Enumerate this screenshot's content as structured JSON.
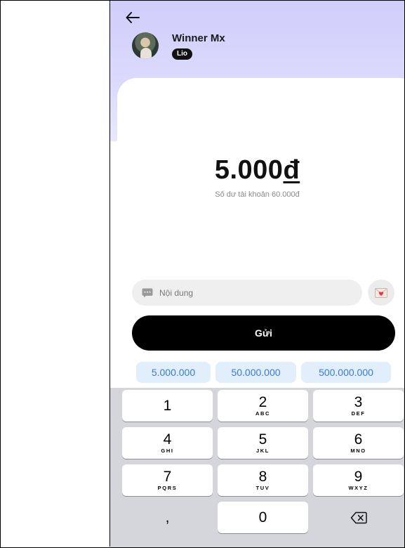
{
  "header": {
    "user_name": "Winner Mx",
    "badge": "Lio"
  },
  "transfer": {
    "amount": "5.000",
    "currency_symbol": "đ",
    "balance_text": "Số dư tài khoản 60.000đ"
  },
  "message": {
    "placeholder": "Nội dung"
  },
  "actions": {
    "send_label": "Gửi"
  },
  "presets": [
    "5.000.000",
    "50.000.000",
    "500.000.000"
  ],
  "keypad": {
    "keys": [
      {
        "digit": "1",
        "letters": ""
      },
      {
        "digit": "2",
        "letters": "ABC"
      },
      {
        "digit": "3",
        "letters": "DEF"
      },
      {
        "digit": "4",
        "letters": "GHI"
      },
      {
        "digit": "5",
        "letters": "JKL"
      },
      {
        "digit": "6",
        "letters": "MNO"
      },
      {
        "digit": "7",
        "letters": "PQRS"
      },
      {
        "digit": "8",
        "letters": "TUV"
      },
      {
        "digit": "9",
        "letters": "WXYZ"
      },
      {
        "digit": ",",
        "letters": ""
      },
      {
        "digit": "0",
        "letters": ""
      }
    ],
    "delete_icon": "backspace-icon"
  },
  "colors": {
    "header_gradient_top": "#cfcdfb",
    "preset_bg": "#e1eefc",
    "preset_text": "#3a7ad8",
    "send_bg": "#000000",
    "keypad_bg": "#d4d6dc"
  }
}
